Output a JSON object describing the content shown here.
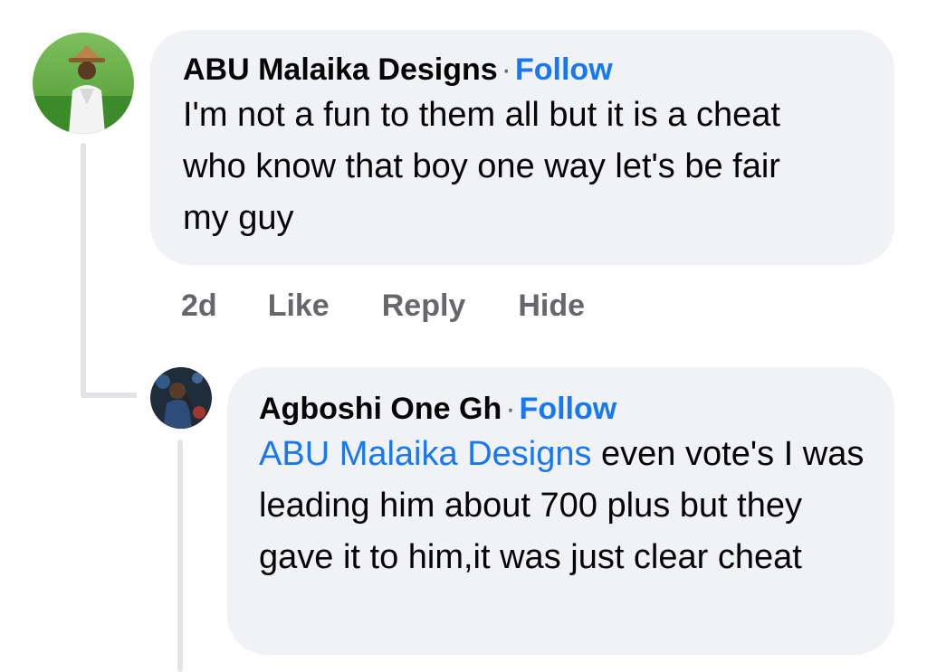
{
  "comment": {
    "author": "ABU Malaika Designs",
    "separator": "·",
    "follow_label": "Follow",
    "text": "I'm not a fun to them all but it is a cheat who know that boy one way let's be fair my guy",
    "actions": {
      "time": "2d",
      "like": "Like",
      "reply": "Reply",
      "hide": "Hide"
    }
  },
  "reply": {
    "author": "Agboshi One Gh",
    "separator": "·",
    "follow_label": "Follow",
    "mention": "ABU Malaika Designs",
    "text": " even vote's I was leading him about 700 plus but they gave it to him,it was just clear cheat"
  },
  "colors": {
    "link": "#1877f2",
    "bubble": "#f0f2f5",
    "muted": "#65676b",
    "thread_line": "#e1e3e6"
  }
}
